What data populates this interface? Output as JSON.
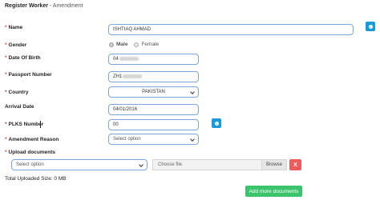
{
  "page_title": {
    "main": "Register Worker",
    "separator": " - ",
    "sub": "Amendment"
  },
  "fields": {
    "name": {
      "label": "Name",
      "required": "*",
      "value": "ISHTIAQ AHMAD"
    },
    "gender": {
      "label": "Gender",
      "required": "*",
      "options": [
        "Male",
        "Female"
      ],
      "selected": "Male"
    },
    "dob": {
      "label": "Date Of Birth",
      "required": "*",
      "value": "04"
    },
    "passport": {
      "label": "Passport Number",
      "required": "*",
      "value": "ZH1"
    },
    "country": {
      "label": "Country",
      "required": "*",
      "value": "PAKISTAN"
    },
    "arrival_date": {
      "label": "Arrival Date",
      "value": "04/01/2016"
    },
    "plks": {
      "label": "PLKS Number",
      "required": "*",
      "value": "00"
    },
    "amendment_reason": {
      "label": "Amendment Reason",
      "required": "*",
      "placeholder": "Select option"
    },
    "upload_documents": {
      "label": "Upload documents",
      "required": "*",
      "placeholder": "Select option"
    }
  },
  "file_input": {
    "placeholder": "Choose file",
    "browse_label": "Browse",
    "remove_label": "X"
  },
  "total_uploaded": "Total Uploaded Size: 0 MB",
  "add_more_label": "Add more documents",
  "colors": {
    "required_star": "#e53935",
    "info_button": "#1c9ad6",
    "remove_button": "#ee5b5b",
    "add_button": "#3cc46c",
    "field_border": "#7aa7d9"
  }
}
